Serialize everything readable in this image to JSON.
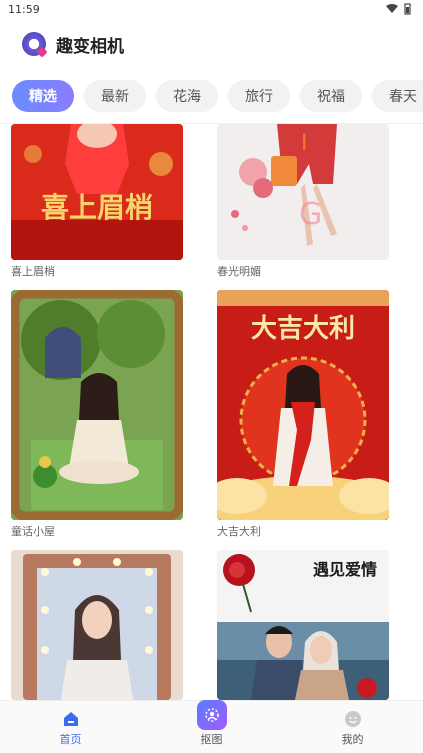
{
  "status_bar": {
    "time": "11:59",
    "wifi_icon": "wifi-icon",
    "battery_icon": "battery-icon"
  },
  "header": {
    "title": "趣变相机",
    "logo_icon": "camera-logo-icon"
  },
  "tabs": [
    {
      "label": "精选",
      "active": true
    },
    {
      "label": "最新",
      "active": false
    },
    {
      "label": "花海",
      "active": false
    },
    {
      "label": "旅行",
      "active": false
    },
    {
      "label": "祝福",
      "active": false
    },
    {
      "label": "春天",
      "active": false
    }
  ],
  "cards": [
    {
      "caption": "喜上眉梢",
      "overlay_text": "喜上眉梢",
      "colors": [
        "#d42a1f",
        "#ff5a3c"
      ]
    },
    {
      "caption": "春光明媚",
      "overlay_text": "",
      "colors": [
        "#f3eeee",
        "#e9e2e2"
      ]
    },
    {
      "caption": "童话小屋",
      "overlay_text": "",
      "colors": [
        "#5d8b3a",
        "#b88a47"
      ]
    },
    {
      "caption": "大吉大利",
      "overlay_text": "大吉大利",
      "colors": [
        "#c81c16",
        "#f5c35a"
      ]
    },
    {
      "caption": "",
      "overlay_text": "",
      "colors": [
        "#e7d7c9",
        "#b87a5e"
      ]
    },
    {
      "caption": "",
      "overlay_text": "遇见爱情",
      "colors": [
        "#f4f4f4",
        "#2f5570"
      ]
    }
  ],
  "bottom_nav": [
    {
      "label": "首页",
      "icon": "home-icon",
      "active": true
    },
    {
      "label": "抠图",
      "icon": "cutout-icon",
      "active": false
    },
    {
      "label": "我的",
      "icon": "profile-icon",
      "active": false
    }
  ],
  "colors": {
    "accent": "#3a6cf2",
    "tab_active_start": "#6b8cff",
    "tab_active_end": "#8c7cff"
  }
}
